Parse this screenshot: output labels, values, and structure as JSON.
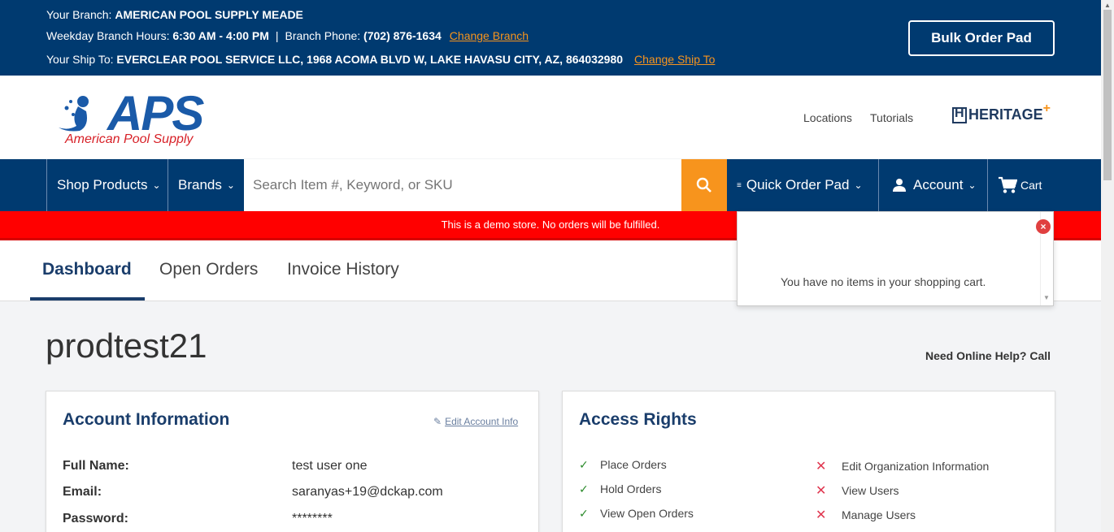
{
  "topbar": {
    "branch_label": "Your Branch: ",
    "branch_value": "AMERICAN POOL SUPPLY MEADE",
    "hours_label": "Weekday Branch Hours: ",
    "hours_value": "6:30 AM - 4:00 PM",
    "separator": "|",
    "phone_label": "Branch Phone: ",
    "phone_value": "(702) 876-1634",
    "change_branch": "Change Branch",
    "ship_label": "Your Ship To: ",
    "ship_value": "EVERCLEAR POOL SERVICE LLC, 1968 ACOMA BLVD W, LAKE HAVASU CITY, AZ, 864032980",
    "change_ship": "Change Ship To",
    "bulk_order": "Bulk Order Pad"
  },
  "header": {
    "logo_text": "APS",
    "logo_sub": "American Pool Supply",
    "locations": "Locations",
    "tutorials": "Tutorials",
    "heritage": "HERITAGE"
  },
  "nav": {
    "shop_products": "Shop Products",
    "brands": "Brands",
    "search_placeholder": "Search Item #, Keyword, or SKU",
    "quick_order": "Quick Order Pad",
    "account": "Account",
    "cart": "Cart"
  },
  "demo_banner": "This is a demo store. No orders will be fulfilled.",
  "tabs": [
    {
      "label": "Dashboard"
    },
    {
      "label": "Open Orders"
    },
    {
      "label": "Invoice History"
    }
  ],
  "cart_popup": {
    "message": "You have no items in your shopping cart."
  },
  "main": {
    "username": "prodtest21",
    "help": "Need Online Help? Call"
  },
  "account_info": {
    "title": "Account Information",
    "edit": "Edit Account Info",
    "rows": [
      {
        "label": "Full Name:",
        "value": "test user one"
      },
      {
        "label": "Email:",
        "value": "saranyas+19@dckap.com"
      },
      {
        "label": "Password:",
        "value": "********"
      }
    ]
  },
  "access_rights": {
    "title": "Access Rights",
    "granted": [
      "Place Orders",
      "Hold Orders",
      "View Open Orders"
    ],
    "denied": [
      "Edit Organization Information",
      "View Users",
      "Manage Users"
    ]
  },
  "colors": {
    "primary": "#003a70",
    "accent": "#f7941d",
    "banner": "#ff0000",
    "title": "#1a3d6b"
  }
}
